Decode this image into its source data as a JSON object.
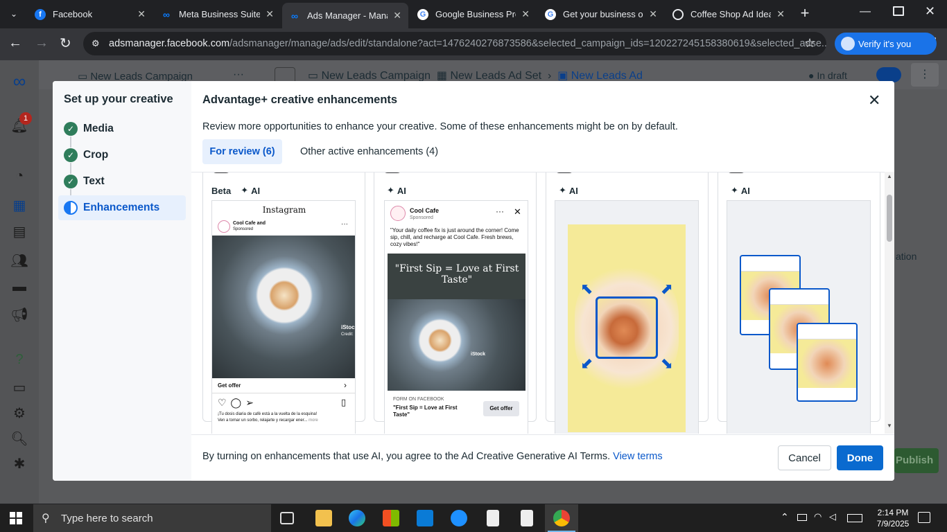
{
  "browser": {
    "tabs": [
      {
        "title": "Facebook",
        "icon": "facebook-icon",
        "color": "#1877f2"
      },
      {
        "title": "Meta Business Suite",
        "icon": "meta-icon",
        "color": "#0a7cff"
      },
      {
        "title": "Ads Manager - Mana",
        "icon": "meta-icon",
        "color": "#0a7cff"
      },
      {
        "title": "Google Business Prof",
        "icon": "google-icon",
        "color": "#ffffff"
      },
      {
        "title": "Get your business on",
        "icon": "google-icon",
        "color": "#ffffff"
      },
      {
        "title": "Coffee Shop Ad Ideas",
        "icon": "openai-icon",
        "color": "#ffffff"
      }
    ],
    "url_host": "adsmanager.facebook.com",
    "url_path": "/adsmanager/manage/ads/edit/standalone?act=1476240276873586&selected_campaign_ids=120227245158380619&selected_adse...",
    "verify_label": "Verify it's you"
  },
  "page": {
    "breadcrumb_campaign": "New Leads Campaign",
    "breadcrumb_campaign_2": "New Leads Campaign",
    "breadcrumb_adset": "New Leads Ad Set",
    "breadcrumb_ad": "New Leads Ad",
    "status": "In draft",
    "right_partial": "ation",
    "publish_label": "Publish",
    "notification_count": "1"
  },
  "modal": {
    "sidebar_title": "Set up your creative",
    "steps": [
      {
        "label": "Media",
        "state": "done"
      },
      {
        "label": "Crop",
        "state": "done"
      },
      {
        "label": "Text",
        "state": "done"
      },
      {
        "label": "Enhancements",
        "state": "active"
      }
    ],
    "title": "Advantage+ creative enhancements",
    "subtitle": "Review more opportunities to enhance your creative. Some of these enhancements might be on by default.",
    "tab_review": "For review (6)",
    "tab_other": "Other active enhancements (4)",
    "cards": [
      {
        "badges": [
          "Beta",
          "AI"
        ],
        "preview": {
          "platform": "Instagram",
          "page_name": "Cool Cafe and",
          "sponsored": "Sponsored",
          "cta": "Get offer",
          "caption_line1": "¡Tu dosis diaria de café está a la vuelta de la esquina!",
          "caption_line2": "Ven a tomar un sorbo, relajarte y recargar ener...",
          "more": "more",
          "watermark": "iStock",
          "credit": "Credit:"
        }
      },
      {
        "badges": [
          "AI"
        ],
        "preview": {
          "page_name": "Cool Cafe",
          "sponsored": "Sponsored",
          "body": "\"Your daily coffee fix is just around the corner! Come sip, chill, and recharge at Cool Cafe. Fresh brews, cozy vibes!\"",
          "overlay_text": "\"First Sip = Love at First Taste\"",
          "form_label": "FORM ON FACEBOOK",
          "headline": "\"First Sip = Love at First Taste\"",
          "cta": "Get offer",
          "watermark": "iStock"
        }
      },
      {
        "badges": [
          "AI"
        ]
      },
      {
        "badges": [
          "AI"
        ]
      }
    ],
    "footer_text": "By turning on enhancements that use AI, you agree to the Ad Creative Generative AI Terms.",
    "footer_link": "View terms",
    "cancel_label": "Cancel",
    "done_label": "Done"
  },
  "taskbar": {
    "search_placeholder": "Type here to search",
    "time": "2:14 PM",
    "date": "7/9/2025"
  },
  "colors": {
    "accent": "#0a6acf",
    "success": "#2f7d5b",
    "tab_bg": "#202124"
  }
}
